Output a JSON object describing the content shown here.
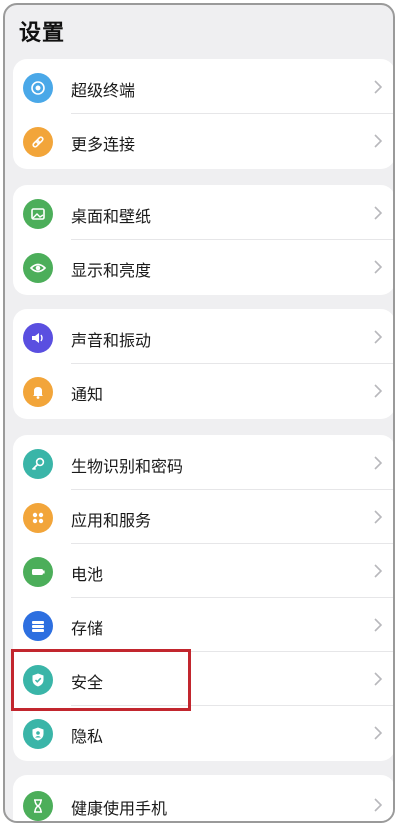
{
  "page": {
    "title": "设置"
  },
  "groups": [
    {
      "items": [
        {
          "label": "超级终端",
          "icon": "super-device-icon",
          "color": "#4aa8e8"
        },
        {
          "label": "更多连接",
          "icon": "link-icon",
          "color": "#f2a53a"
        }
      ]
    },
    {
      "items": [
        {
          "label": "桌面和壁纸",
          "icon": "wallpaper-icon",
          "color": "#4cae5a"
        },
        {
          "label": "显示和亮度",
          "icon": "eye-icon",
          "color": "#4cae5a"
        }
      ]
    },
    {
      "items": [
        {
          "label": "声音和振动",
          "icon": "speaker-icon",
          "color": "#5a4fe0"
        },
        {
          "label": "通知",
          "icon": "bell-icon",
          "color": "#f2a53a"
        }
      ]
    },
    {
      "items": [
        {
          "label": "生物识别和密码",
          "icon": "key-icon",
          "color": "#3ab5a8"
        },
        {
          "label": "应用和服务",
          "icon": "apps-icon",
          "color": "#f2a53a"
        },
        {
          "label": "电池",
          "icon": "battery-icon",
          "color": "#4cae5a"
        },
        {
          "label": "存储",
          "icon": "storage-icon",
          "color": "#2d6fe0"
        },
        {
          "label": "安全",
          "icon": "shield-icon",
          "color": "#3ab5a8"
        },
        {
          "label": "隐私",
          "icon": "privacy-shield-icon",
          "color": "#3ab5a8"
        }
      ]
    },
    {
      "items": [
        {
          "label": "健康使用手机",
          "icon": "hourglass-icon",
          "color": "#4cae5a"
        }
      ]
    }
  ],
  "highlight_color": "#c2262e"
}
